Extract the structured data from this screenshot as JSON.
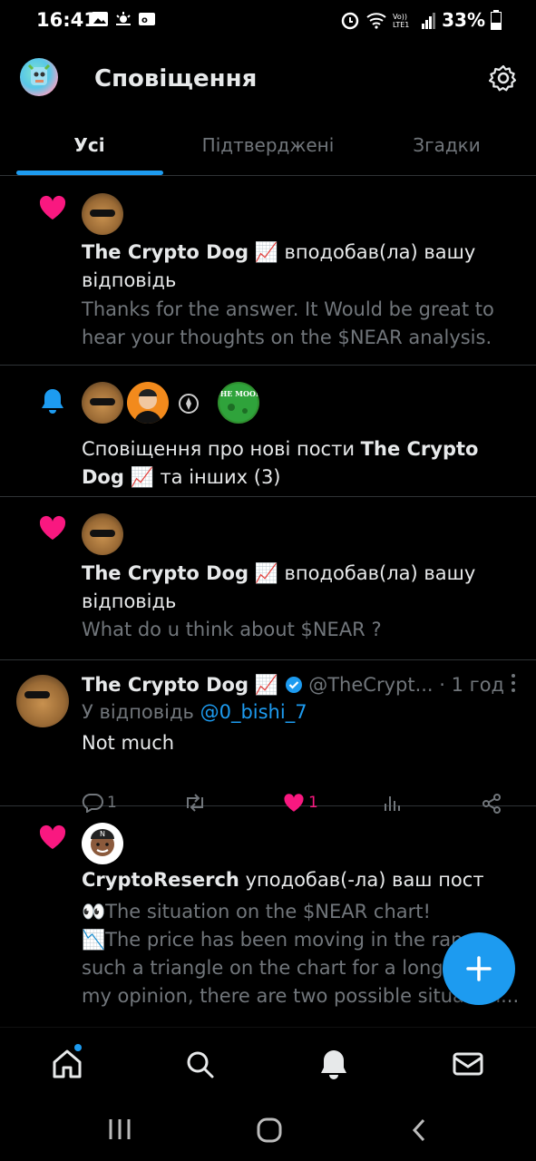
{
  "status_bar": {
    "time": "16:41",
    "battery": "33%",
    "icons": [
      "gallery-icon",
      "weather-icon",
      "outlook-icon",
      "alarm-icon",
      "wifi-icon",
      "volte-icon",
      "signal-icon",
      "battery-icon"
    ]
  },
  "header": {
    "title": "Сповіщення"
  },
  "tabs": [
    {
      "label": "Усі",
      "active": true
    },
    {
      "label": "Підтверджені",
      "active": false
    },
    {
      "label": "Згадки",
      "active": false
    }
  ],
  "notifications": [
    {
      "type": "like",
      "actor": "The Crypto Dog",
      "emoji": "📈",
      "action": "вподобав(ла) вашу відповідь",
      "snippet_line1": "Thanks for the answer. It Would be great to",
      "snippet_line2": "hear your thoughts on the $NEAR analysis."
    },
    {
      "type": "new_posts",
      "prefix": "Сповіщення про нові пости",
      "actor": "The Crypto Dog",
      "emoji": "📈",
      "suffix": "та інших (3)",
      "avatar4_text": "THE MOON"
    },
    {
      "type": "like",
      "actor": "The Crypto Dog",
      "emoji": "📈",
      "action": "вподобав(ла) вашу відповідь",
      "snippet_line1": "What do u think about $NEAR ?"
    },
    {
      "type": "reply",
      "author": "The Crypto Dog",
      "emoji": "📈",
      "handle": "@TheCrypt...",
      "time": "· 1 год",
      "reply_prefix": "У відповідь",
      "reply_to": "@0_bishi_7",
      "body": "Not much",
      "reply_count": "1",
      "like_count": "1"
    },
    {
      "type": "like",
      "actor": "CryptoReserch",
      "action": "уподобав(-ла) ваш пост",
      "avatar_letter": "N",
      "snippet_line1": "👀The situation on the $NEAR chart!",
      "snippet_line2": "📉The price has been moving in the ran",
      "snippet_line3": "such a triangle on the chart for a long t",
      "snippet_line4": "my opinion, there are two possible situation..."
    }
  ],
  "bottom_nav": [
    "home-icon",
    "search-icon",
    "notifications-icon",
    "messages-icon"
  ],
  "colors": {
    "accent": "#1d9bf0",
    "like": "#f91880",
    "secondary_text": "#71767b",
    "divider": "#2f3336"
  }
}
